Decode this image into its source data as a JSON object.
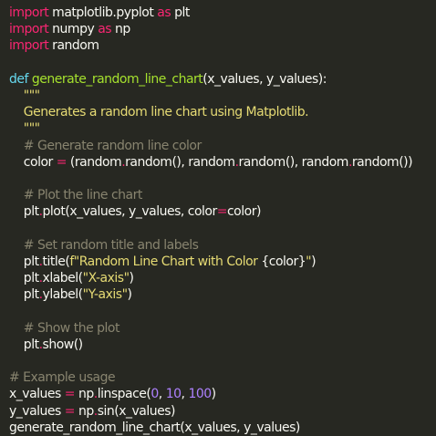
{
  "editor": {
    "language": "python",
    "theme_colors": {
      "background": "#272822",
      "keyword": "#f92672",
      "def": "#66d9ef",
      "function": "#a6e22e",
      "string": "#e6db74",
      "number": "#ae81ff",
      "comment": "#88846f",
      "text": "#f8f8f2"
    },
    "lines": [
      [
        {
          "t": "kw",
          "v": "import"
        },
        {
          "t": "txt",
          "v": " matplotlib.pyplot "
        },
        {
          "t": "kw",
          "v": "as"
        },
        {
          "t": "txt",
          "v": " plt"
        }
      ],
      [
        {
          "t": "kw",
          "v": "import"
        },
        {
          "t": "txt",
          "v": " numpy "
        },
        {
          "t": "kw",
          "v": "as"
        },
        {
          "t": "txt",
          "v": " np"
        }
      ],
      [
        {
          "t": "kw",
          "v": "import"
        },
        {
          "t": "txt",
          "v": " random"
        }
      ],
      [],
      [
        {
          "t": "def",
          "v": "def"
        },
        {
          "t": "txt",
          "v": " "
        },
        {
          "t": "fn",
          "v": "generate_random_line_chart"
        },
        {
          "t": "txt",
          "v": "(x_values, y_values):"
        }
      ],
      [
        {
          "t": "str",
          "v": "    \"\"\""
        }
      ],
      [
        {
          "t": "str",
          "v": "    Generates a random line chart using Matplotlib."
        }
      ],
      [
        {
          "t": "str",
          "v": "    \"\"\""
        }
      ],
      [
        {
          "t": "com",
          "v": "    # Generate random line color"
        }
      ],
      [
        {
          "t": "txt",
          "v": "    color "
        },
        {
          "t": "op",
          "v": "="
        },
        {
          "t": "txt",
          "v": " (random"
        },
        {
          "t": "op",
          "v": "."
        },
        {
          "t": "txt",
          "v": "random(), random"
        },
        {
          "t": "op",
          "v": "."
        },
        {
          "t": "txt",
          "v": "random(), random"
        },
        {
          "t": "op",
          "v": "."
        },
        {
          "t": "txt",
          "v": "random())"
        }
      ],
      [],
      [
        {
          "t": "com",
          "v": "    # Plot the line chart"
        }
      ],
      [
        {
          "t": "txt",
          "v": "    plt"
        },
        {
          "t": "op",
          "v": "."
        },
        {
          "t": "txt",
          "v": "plot(x_values, y_values, color"
        },
        {
          "t": "op",
          "v": "="
        },
        {
          "t": "txt",
          "v": "color)"
        }
      ],
      [],
      [
        {
          "t": "com",
          "v": "    # Set random title and labels"
        }
      ],
      [
        {
          "t": "txt",
          "v": "    plt"
        },
        {
          "t": "op",
          "v": "."
        },
        {
          "t": "txt",
          "v": "title("
        },
        {
          "t": "str",
          "v": "f\"Random Line Chart with Color "
        },
        {
          "t": "txt",
          "v": "{color}"
        },
        {
          "t": "str",
          "v": "\""
        },
        {
          "t": "txt",
          "v": ")"
        }
      ],
      [
        {
          "t": "txt",
          "v": "    plt"
        },
        {
          "t": "op",
          "v": "."
        },
        {
          "t": "txt",
          "v": "xlabel("
        },
        {
          "t": "str",
          "v": "\"X-axis\""
        },
        {
          "t": "txt",
          "v": ")"
        }
      ],
      [
        {
          "t": "txt",
          "v": "    plt"
        },
        {
          "t": "op",
          "v": "."
        },
        {
          "t": "txt",
          "v": "ylabel("
        },
        {
          "t": "str",
          "v": "\"Y-axis\""
        },
        {
          "t": "txt",
          "v": ")"
        }
      ],
      [],
      [
        {
          "t": "com",
          "v": "    # Show the plot"
        }
      ],
      [
        {
          "t": "txt",
          "v": "    plt"
        },
        {
          "t": "op",
          "v": "."
        },
        {
          "t": "txt",
          "v": "show()"
        }
      ],
      [],
      [
        {
          "t": "com",
          "v": "# Example usage"
        }
      ],
      [
        {
          "t": "txt",
          "v": "x_values "
        },
        {
          "t": "op",
          "v": "="
        },
        {
          "t": "txt",
          "v": " np"
        },
        {
          "t": "op",
          "v": "."
        },
        {
          "t": "txt",
          "v": "linspace("
        },
        {
          "t": "num",
          "v": "0"
        },
        {
          "t": "txt",
          "v": ", "
        },
        {
          "t": "num",
          "v": "10"
        },
        {
          "t": "txt",
          "v": ", "
        },
        {
          "t": "num",
          "v": "100"
        },
        {
          "t": "txt",
          "v": ")"
        }
      ],
      [
        {
          "t": "txt",
          "v": "y_values "
        },
        {
          "t": "op",
          "v": "="
        },
        {
          "t": "txt",
          "v": " np"
        },
        {
          "t": "op",
          "v": "."
        },
        {
          "t": "txt",
          "v": "sin(x_values)"
        }
      ],
      [
        {
          "t": "txt",
          "v": "generate_random_line_chart(x_values, y_values)"
        }
      ]
    ]
  }
}
